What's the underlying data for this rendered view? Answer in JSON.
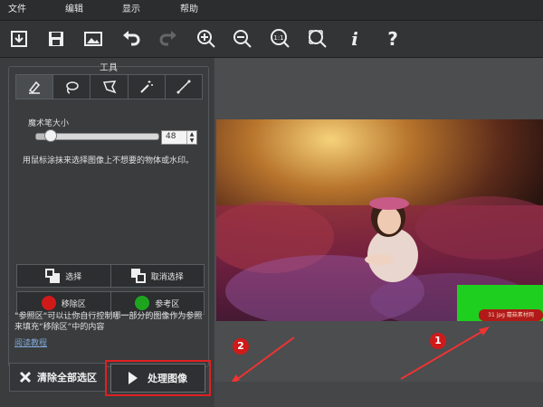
{
  "menu": {
    "file": "文件",
    "edit": "编辑",
    "view": "显示",
    "help": "帮助"
  },
  "toolbar_icons": [
    "open-icon",
    "save-icon",
    "image-icon",
    "undo-icon",
    "redo-icon",
    "zoom-in-icon",
    "zoom-out-icon",
    "actual-size-icon",
    "fit-icon",
    "info-icon",
    "help-icon"
  ],
  "toolbar_glyphs": {
    "info": "i",
    "help": "?",
    "actual_size": "1:1"
  },
  "tools": {
    "title": "工具",
    "tabs": [
      "brush-icon",
      "lasso-icon",
      "polygon-lasso-icon",
      "magic-wand-icon",
      "line-icon"
    ],
    "brush_size_label": "魔术笔大小",
    "brush_size_value": "48",
    "brush_size_fraction": 0.12,
    "instruction": "用鼠标涂抹来选择图像上不想要的物体或水印。",
    "select_label": "选择",
    "deselect_label": "取消选择",
    "remove_area_label": "移除区",
    "reference_area_label": "参考区",
    "hint": "“参照区”可以让你自行控制哪一部分的图像作为参照来填充“移除区”中的内容",
    "link": "阅读教程"
  },
  "actions": {
    "clear_label": "清除全部选区",
    "process_label": "处理图像"
  },
  "canvas": {
    "watermark": "31 jpg 蘑菇素材网"
  },
  "annotations": {
    "one": "1",
    "two": "2"
  },
  "colors": {
    "remove": "#d01a1a",
    "reference": "#1ea51e",
    "highlight": "#e02020"
  }
}
